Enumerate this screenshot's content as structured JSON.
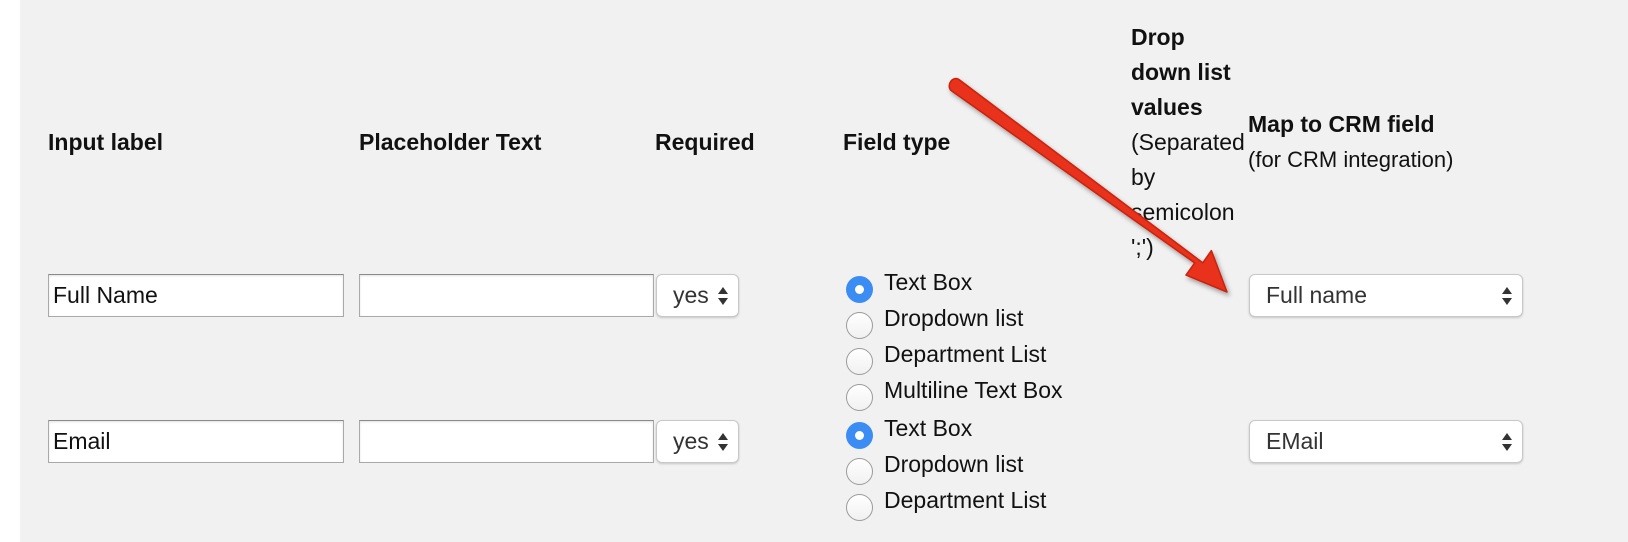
{
  "headers": {
    "input_label": "Input label",
    "placeholder_text": "Placeholder Text",
    "required": "Required",
    "field_type": "Field type",
    "dropdown_values_line1": "Drop",
    "dropdown_values_line2": "down list",
    "dropdown_values_line3": "values",
    "dropdown_values_note1": "(Separated",
    "dropdown_values_note2": "by",
    "dropdown_values_note3": "semicolon",
    "dropdown_values_note4": "';')",
    "crm_title": "Map to CRM field",
    "crm_subtitle": "(for CRM integration)"
  },
  "rows": [
    {
      "input_label_value": "Full Name",
      "placeholder_value": "",
      "required_value": "yes",
      "field_type_options": [
        "Text Box",
        "Dropdown list",
        "Department List",
        "Multiline Text Box"
      ],
      "field_type_selected": "Text Box",
      "crm_value": "Full name"
    },
    {
      "input_label_value": "Email",
      "placeholder_value": "",
      "required_value": "yes",
      "field_type_options": [
        "Text Box",
        "Dropdown list",
        "Department List"
      ],
      "field_type_selected": "Text Box",
      "crm_value": "EMail"
    }
  ],
  "colors": {
    "panel_background": "#f1f1f1",
    "radio_checked": "#3b8df4",
    "annotation_arrow": "#e8301c"
  },
  "icons": {
    "select_indicator": "updown-chevron-icon",
    "annotation": "red-arrow-icon"
  }
}
